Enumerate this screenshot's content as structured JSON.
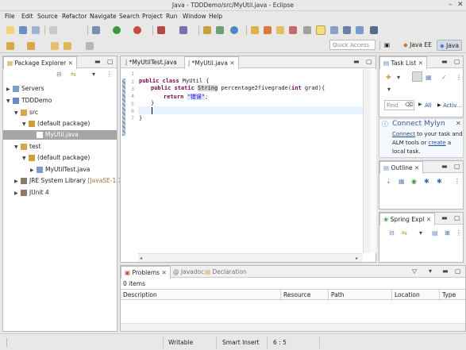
{
  "window": {
    "title": "Java - TDDDemo/src/MyUtil.java - Eclipse"
  },
  "menu": [
    "File",
    "Edit",
    "Source",
    "Refactor",
    "Navigate",
    "Search",
    "Project",
    "Run",
    "Window",
    "Help"
  ],
  "quick_access": {
    "placeholder": "Quick Access"
  },
  "perspectives": [
    {
      "label": "Java EE"
    },
    {
      "label": "Java"
    }
  ],
  "package_explorer": {
    "title": "Package Explorer",
    "items": [
      {
        "label": "Servers"
      },
      {
        "label": "TDDDemo"
      },
      {
        "label": "src"
      },
      {
        "label": "(default package)"
      },
      {
        "label": "MyUtil.java"
      },
      {
        "label": "test"
      },
      {
        "label": "(default package)"
      },
      {
        "label": "MyUtilTest.java"
      },
      {
        "label": "JRE System Library",
        "suffix": "[JavaSE-1.7]"
      },
      {
        "label": "JUnit 4"
      }
    ]
  },
  "editor": {
    "tabs": [
      {
        "label": "*MyUtilTest.java"
      },
      {
        "label": "*MyUtil.java"
      }
    ],
    "line_numbers": [
      "1",
      "2",
      "3",
      "4",
      "5",
      "6",
      "7"
    ],
    "code": {
      "l2_kw": "public class",
      "l2_rest": " MyUtil {",
      "l3_kw": "public static",
      "l3_type": "String",
      "l3_rest": " percentage2fivegrade(",
      "l3_kw2": "int",
      "l3_rest2": " grad){",
      "l4_kw": "return",
      "l4_str": "\"错误\"",
      "l4_end": ";",
      "l5": "}",
      "l7": "}"
    }
  },
  "task_list": {
    "title": "Task List",
    "find_placeholder": "Find",
    "all_label": "All",
    "activate_label": "Activ..."
  },
  "mylyn": {
    "title": "Connect Mylyn",
    "link1": "Connect",
    "text1": " to your task and",
    "text2": "ALM tools or ",
    "link2": "create",
    "text3": " a",
    "text4": "local task."
  },
  "outline": {
    "title": "Outline"
  },
  "spring": {
    "title": "Spring Expl"
  },
  "problems": {
    "tabs": [
      {
        "label": "Problems"
      },
      {
        "label": "Javadoc"
      },
      {
        "label": "Declaration"
      }
    ],
    "count": "0 items",
    "columns": [
      "Description",
      "Resource",
      "Path",
      "Location",
      "Type"
    ]
  },
  "status": {
    "writable": "Writable",
    "insert": "Smart Insert",
    "position": "6 : 5"
  },
  "colors": {
    "keyword": "#7f0055",
    "string": "#2a00ff",
    "type": "#7f0055",
    "link": "#1d4fa3",
    "selection": "#a6a6a6"
  },
  "icons": [
    "new-icon",
    "save-icon",
    "debug-icon",
    "run-icon",
    "external-tools-icon",
    "new-java-project-icon",
    "new-package-icon",
    "new-class-icon",
    "open-type-icon",
    "search-icon",
    "pin-icon",
    "back-icon",
    "forward-icon",
    "minimize-icon",
    "maximize-icon",
    "collapse-all-icon",
    "link-editor-icon",
    "view-menu-icon",
    "close-icon"
  ]
}
